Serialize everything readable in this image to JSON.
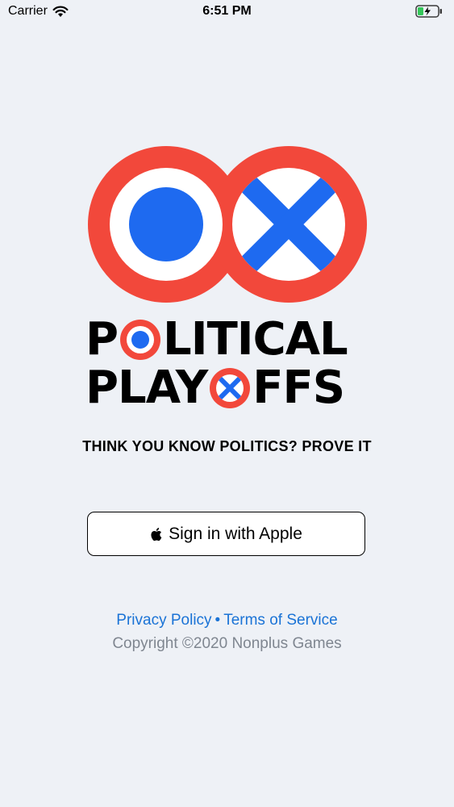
{
  "status_bar": {
    "carrier": "Carrier",
    "time": "6:51 PM",
    "wifi_icon": "wifi-icon",
    "battery_icon": "battery-charging-icon"
  },
  "logo": {
    "line1_text": "LITICAL",
    "line1_prefix": "P",
    "line2_prefix": "PLAY",
    "line2_suffix": "FFS",
    "colors": {
      "red": "#f2483b",
      "blue": "#1e6af0",
      "black": "#0a0a0a",
      "white": "#ffffff"
    }
  },
  "tagline": "THINK YOU KNOW POLITICS? PROVE IT",
  "sign_in": {
    "label": "Sign in with Apple",
    "icon": "apple-logo-icon"
  },
  "footer": {
    "privacy_label": "Privacy Policy",
    "separator": "•",
    "terms_label": "Terms of Service",
    "copyright": "Copyright ©2020 Nonplus Games"
  }
}
